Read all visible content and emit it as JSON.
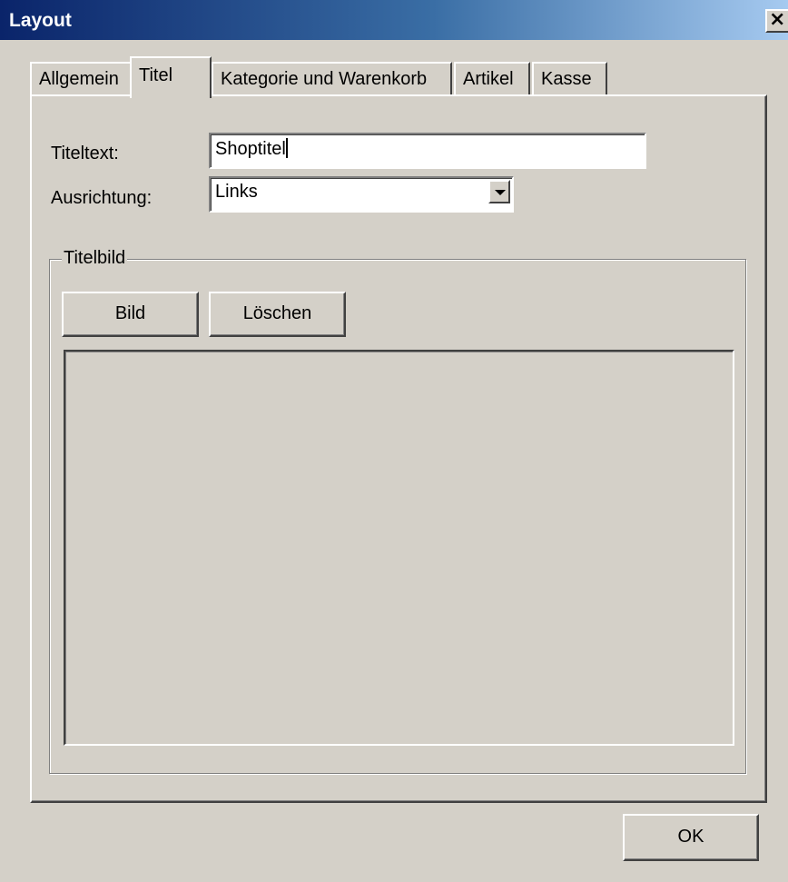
{
  "window": {
    "title": "Layout",
    "close_glyph": "×"
  },
  "tabs": [
    {
      "label": "Allgemein",
      "active": false
    },
    {
      "label": "Titel",
      "active": true
    },
    {
      "label": "Kategorie und Warenkorb",
      "active": false
    },
    {
      "label": "Artikel",
      "active": false
    },
    {
      "label": "Kasse",
      "active": false
    }
  ],
  "form": {
    "title_text_label": "Titeltext:",
    "title_text_value": "Shoptitel",
    "alignment_label": "Ausrichtung:",
    "alignment_value": "Links"
  },
  "title_image_group": {
    "legend": "Titelbild",
    "image_button": "Bild",
    "delete_button": "Löschen"
  },
  "footer": {
    "ok_button": "OK"
  },
  "colors": {
    "face": "#d4d0c8",
    "titlebar_start": "#0a246a",
    "titlebar_end": "#a6caf0",
    "title_text": "#ffffff"
  }
}
